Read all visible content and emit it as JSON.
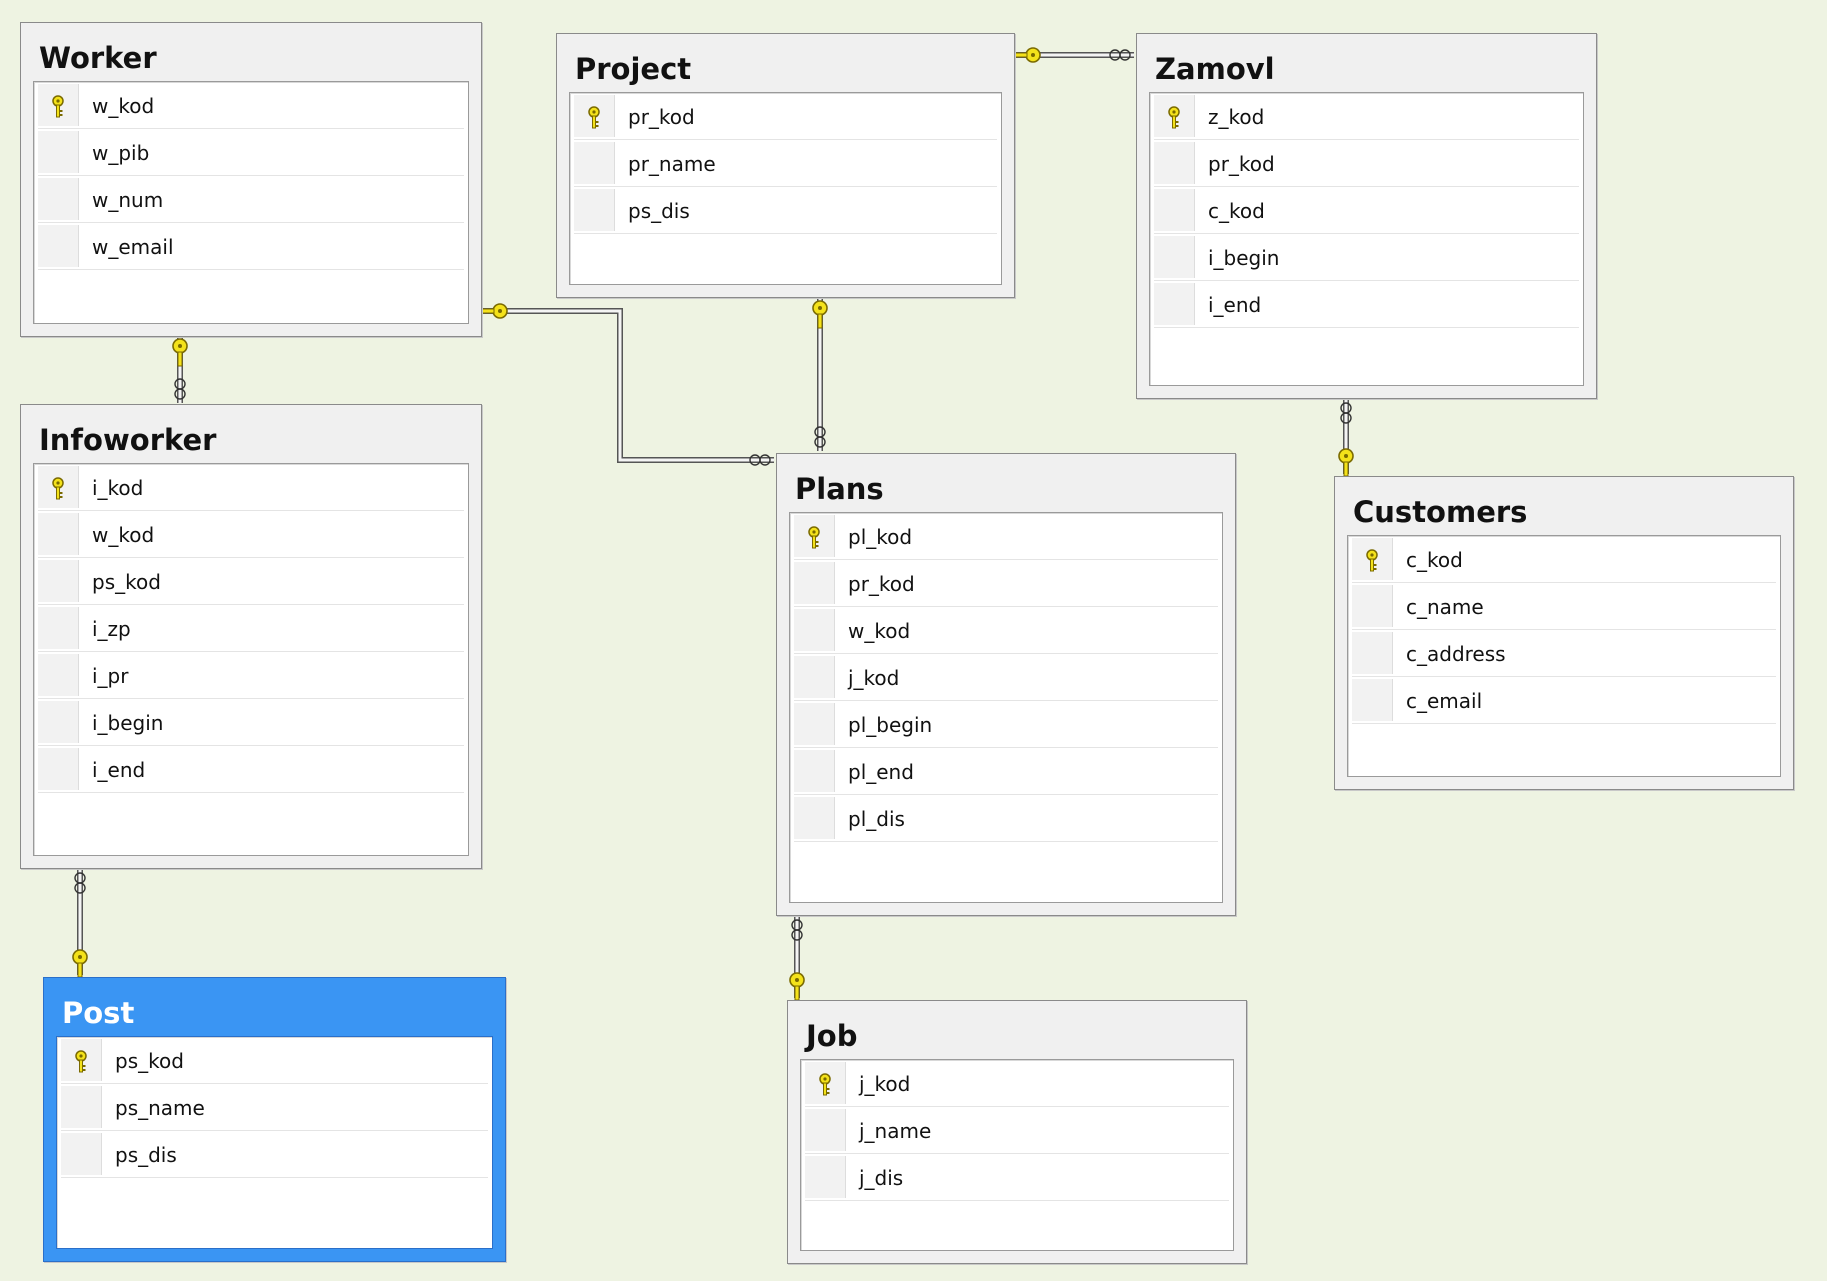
{
  "tables": [
    {
      "name": "Worker",
      "columns": [
        "w_kod",
        "w_pib",
        "w_num",
        "w_email"
      ],
      "primary_key": "w_kod",
      "selected": false
    },
    {
      "name": "Project",
      "columns": [
        "pr_kod",
        "pr_name",
        "ps_dis"
      ],
      "primary_key": "pr_kod",
      "selected": false
    },
    {
      "name": "Zamovl",
      "columns": [
        "z_kod",
        "pr_kod",
        "c_kod",
        "i_begin",
        "i_end"
      ],
      "primary_key": "z_kod",
      "selected": false
    },
    {
      "name": "Infoworker",
      "columns": [
        "i_kod",
        "w_kod",
        "ps_kod",
        "i_zp",
        "i_pr",
        "i_begin",
        "i_end"
      ],
      "primary_key": "i_kod",
      "selected": false
    },
    {
      "name": "Plans",
      "columns": [
        "pl_kod",
        "pr_kod",
        "w_kod",
        "j_kod",
        "pl_begin",
        "pl_end",
        "pl_dis"
      ],
      "primary_key": "pl_kod",
      "selected": false
    },
    {
      "name": "Customers",
      "columns": [
        "c_kod",
        "c_name",
        "c_address",
        "c_email"
      ],
      "primary_key": "c_kod",
      "selected": false
    },
    {
      "name": "Post",
      "columns": [
        "ps_kod",
        "ps_name",
        "ps_dis"
      ],
      "primary_key": "ps_kod",
      "selected": true
    },
    {
      "name": "Job",
      "columns": [
        "j_kod",
        "j_name",
        "j_dis"
      ],
      "primary_key": "j_kod",
      "selected": false
    }
  ],
  "relationships": [
    {
      "one": "Worker",
      "many": "Infoworker"
    },
    {
      "one": "Worker",
      "many": "Plans"
    },
    {
      "one": "Project",
      "many": "Plans"
    },
    {
      "one": "Project",
      "many": "Zamovl"
    },
    {
      "one": "Customers",
      "many": "Zamovl"
    },
    {
      "one": "Post",
      "many": "Infoworker"
    },
    {
      "one": "Job",
      "many": "Plans"
    }
  ],
  "colors": {
    "background": "#eef3e2",
    "selected_header": "#3a95f3",
    "key": "#f4e21a",
    "key_outline": "#7a6a00"
  }
}
